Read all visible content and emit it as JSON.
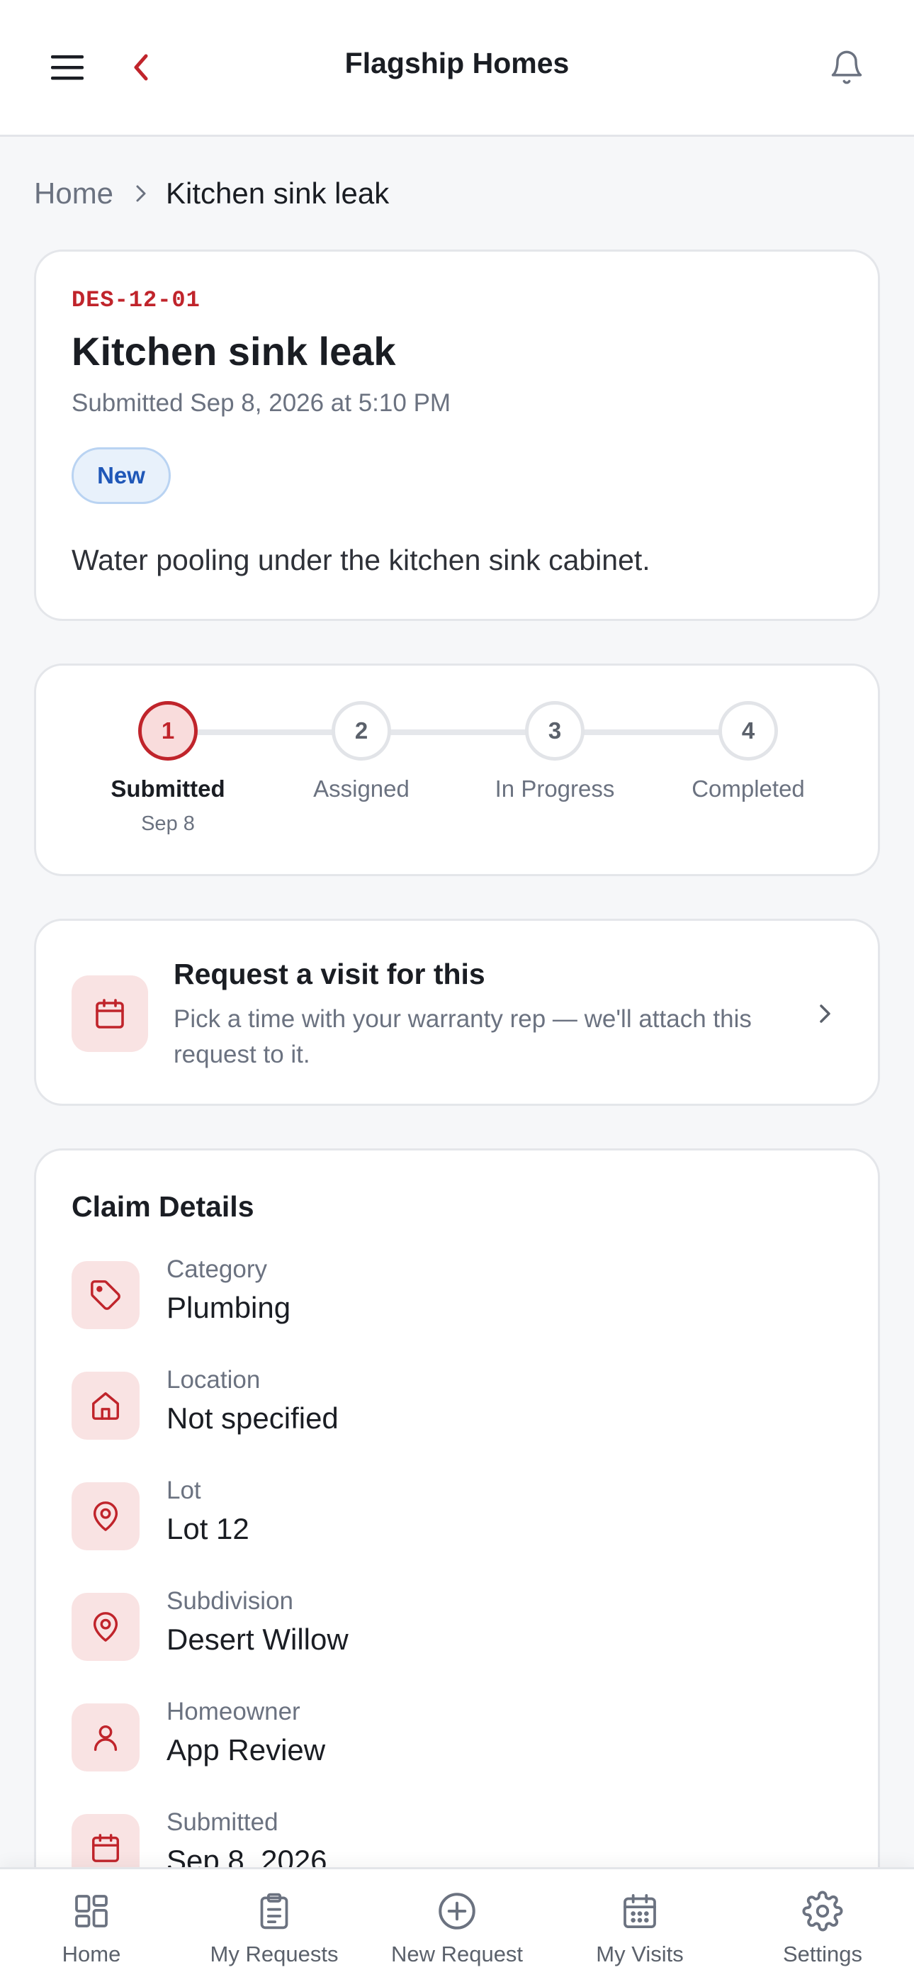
{
  "header": {
    "title": "Flagship Homes",
    "menu_icon": "hamburger-menu-icon",
    "back_icon": "chevron-left-icon",
    "bell_icon": "bell-icon"
  },
  "breadcrumb": {
    "home": "Home",
    "current": "Kitchen sink leak"
  },
  "claim": {
    "code": "DES-12-01",
    "title": "Kitchen sink leak",
    "submitted": "Submitted Sep 8, 2026 at 5:10 PM",
    "status": "New",
    "description": "Water pooling under the kitchen sink cabinet."
  },
  "progress": {
    "steps": [
      {
        "number": "1",
        "label": "Submitted",
        "date": "Sep 8",
        "active": true
      },
      {
        "number": "2",
        "label": "Assigned",
        "date": "",
        "active": false
      },
      {
        "number": "3",
        "label": "In Progress",
        "date": "",
        "active": false
      },
      {
        "number": "4",
        "label": "Completed",
        "date": "",
        "active": false
      }
    ]
  },
  "visit_card": {
    "title": "Request a visit for this",
    "description": "Pick a time with your warranty rep — we'll attach this request to it.",
    "icon": "calendar-icon"
  },
  "claim_details": {
    "title": "Claim Details",
    "rows": [
      {
        "label": "Category",
        "value": "Plumbing",
        "icon": "tag-icon"
      },
      {
        "label": "Location",
        "value": "Not specified",
        "icon": "home-icon"
      },
      {
        "label": "Lot",
        "value": "Lot 12",
        "icon": "map-pin-icon"
      },
      {
        "label": "Subdivision",
        "value": "Desert Willow",
        "icon": "map-pin-icon"
      },
      {
        "label": "Homeowner",
        "value": "App Review",
        "icon": "user-icon"
      },
      {
        "label": "Submitted",
        "value": "Sep 8, 2026",
        "icon": "calendar-icon"
      }
    ]
  },
  "bottom_nav": {
    "items": [
      {
        "label": "Home",
        "icon": "grid-icon"
      },
      {
        "label": "My Requests",
        "icon": "clipboard-icon"
      },
      {
        "label": "New Request",
        "icon": "plus-circle-icon"
      },
      {
        "label": "My Visits",
        "icon": "calendar-icon"
      },
      {
        "label": "Settings",
        "icon": "gear-icon"
      }
    ]
  },
  "colors": {
    "accent": "#c0242b",
    "badge_blue": "#1f57b8",
    "muted_text": "#6b7280"
  }
}
